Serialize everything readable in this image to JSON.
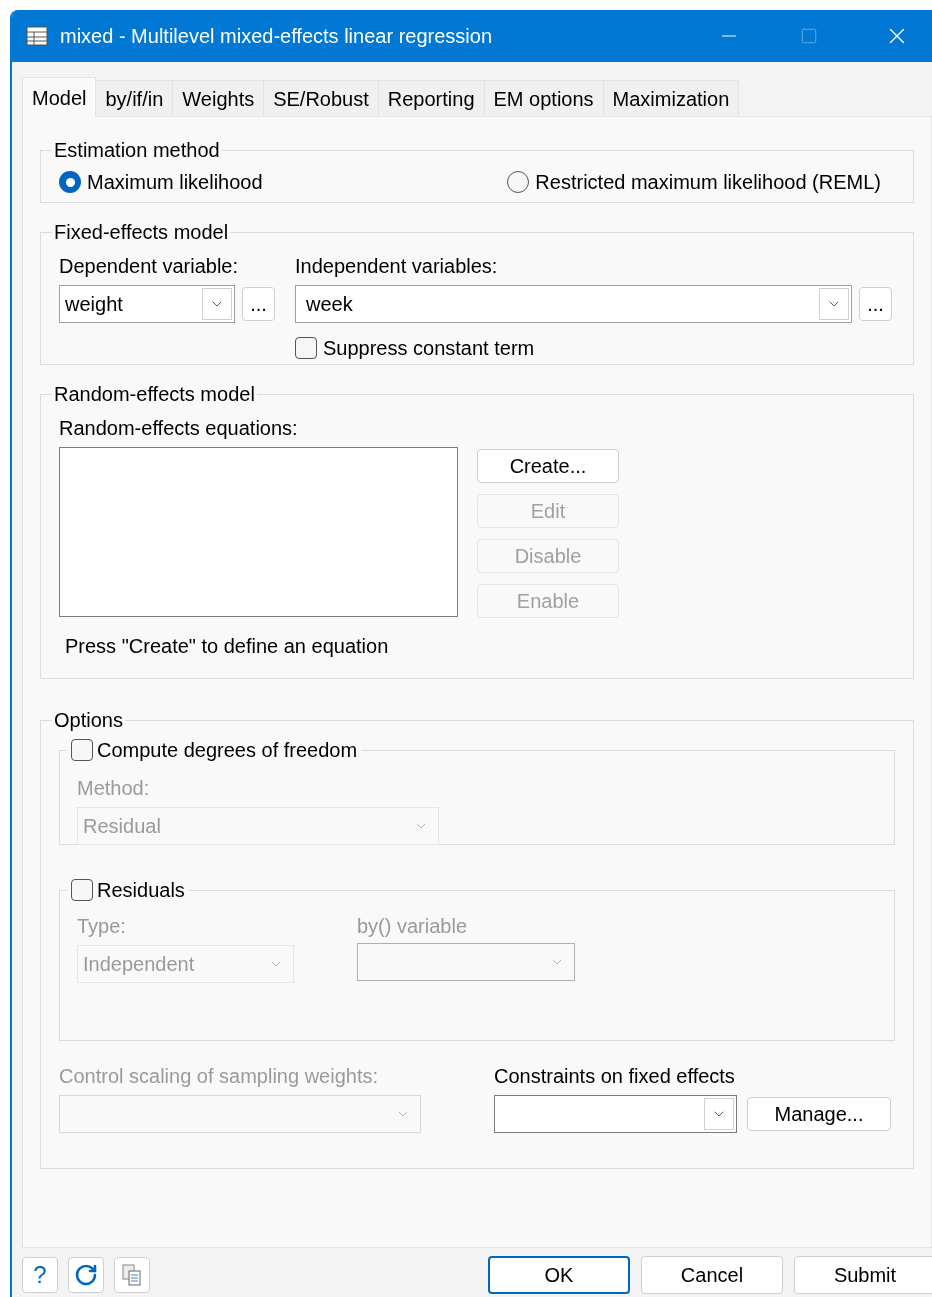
{
  "window": {
    "title": "mixed - Multilevel mixed-effects linear regression"
  },
  "tabs": [
    {
      "label": "Model",
      "selected": true
    },
    {
      "label": "by/if/in",
      "selected": false
    },
    {
      "label": "Weights",
      "selected": false
    },
    {
      "label": "SE/Robust",
      "selected": false
    },
    {
      "label": "Reporting",
      "selected": false
    },
    {
      "label": "EM options",
      "selected": false
    },
    {
      "label": "Maximization",
      "selected": false
    }
  ],
  "estimation_method": {
    "legend": "Estimation method",
    "options": [
      {
        "label": "Maximum likelihood",
        "selected": true
      },
      {
        "label": "Restricted maximum likelihood (REML)",
        "selected": false
      }
    ]
  },
  "fixed_effects": {
    "legend": "Fixed-effects model",
    "dependent_variable": {
      "label": "Dependent variable:",
      "value": "weight",
      "browse": "..."
    },
    "independent_variables": {
      "label": "Independent variables:",
      "value": "week",
      "browse": "..."
    },
    "suppress_constant": {
      "label": "Suppress constant term",
      "checked": false
    }
  },
  "random_effects": {
    "legend": "Random-effects model",
    "equations_label": "Random-effects equations:",
    "buttons": [
      {
        "label": "Create...",
        "disabled": false
      },
      {
        "label": "Edit",
        "disabled": true
      },
      {
        "label": "Disable",
        "disabled": true
      },
      {
        "label": "Enable",
        "disabled": true
      }
    ],
    "hint": "Press \"Create\" to define an equation"
  },
  "options": {
    "legend": "Options",
    "dof": {
      "label": "Compute degrees of freedom",
      "checked": false,
      "method_label": "Method:",
      "method_value": "Residual"
    },
    "residuals": {
      "label": "Residuals",
      "checked": false,
      "type_label": "Type:",
      "type_value": "Independent",
      "by_label": "by() variable"
    },
    "sampling_weights": {
      "label": "Control scaling of sampling weights:",
      "disabled": true
    },
    "constraints": {
      "label": "Constraints on fixed effects",
      "disabled": false
    },
    "manage_button": "Manage..."
  },
  "footer": {
    "tools": [
      {
        "kind": "help",
        "label": "?"
      },
      {
        "kind": "reset"
      },
      {
        "kind": "copy"
      }
    ],
    "buttons": [
      {
        "label": "OK",
        "default": true
      },
      {
        "label": "Cancel",
        "default": false
      },
      {
        "label": "Submit",
        "default": false
      }
    ]
  }
}
